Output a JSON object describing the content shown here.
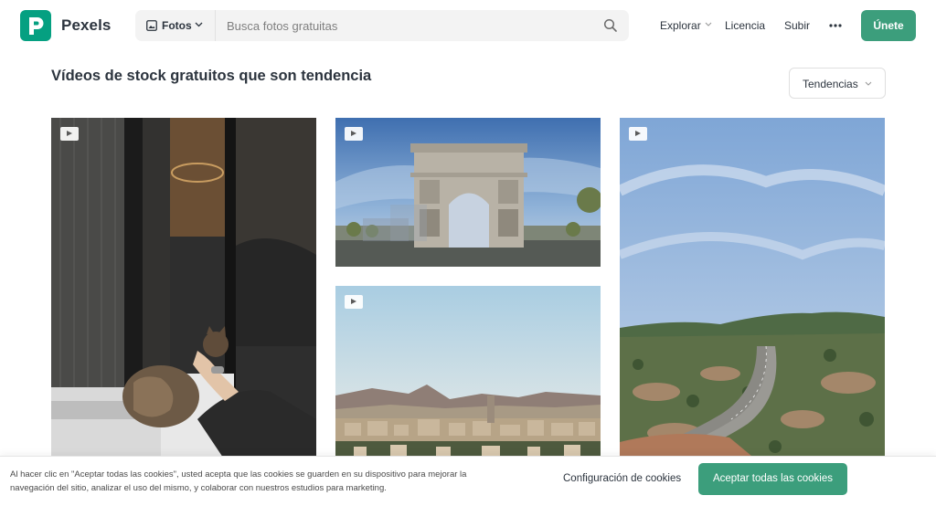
{
  "header": {
    "brand": "Pexels",
    "search": {
      "type_label": "Fotos",
      "placeholder": "Busca fotos gratuitas",
      "value": ""
    },
    "nav": {
      "explore": "Explorar",
      "license": "Licencia",
      "upload": "Subir",
      "join": "Únete"
    }
  },
  "main": {
    "title": "Vídeos de stock gratuitos que son tendencia",
    "sort_label": "Tendencias"
  },
  "cookie": {
    "text": "Al hacer clic en \"Aceptar todas las cookies\", usted acepta que las cookies se guarden en su dispositivo para mejorar la navegación del sitio, analizar el uso del mismo, y colaborar con nuestros estudios para marketing.",
    "config": "Configuración de cookies",
    "accept": "Aceptar todas las cookies"
  },
  "colors": {
    "brand": "#05a081",
    "button": "#3c9e7c",
    "text": "#2c343e"
  }
}
